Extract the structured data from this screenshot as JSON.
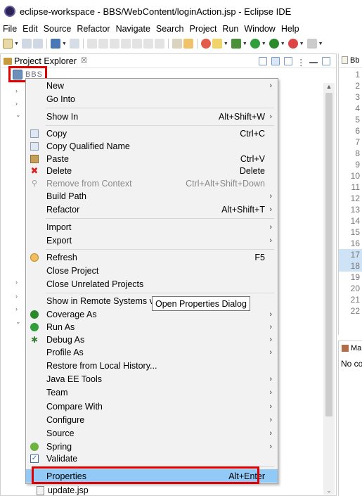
{
  "window": {
    "title": "eclipse-workspace - BBS/WebContent/loginAction.jsp - Eclipse IDE"
  },
  "menubar": [
    "File",
    "Edit",
    "Source",
    "Refactor",
    "Navigate",
    "Search",
    "Project",
    "Run",
    "Window",
    "Help"
  ],
  "explorer": {
    "title": "Project Explorer",
    "close": "☒",
    "project_name": "BBS",
    "bottom_file": "update.jsp"
  },
  "editor": {
    "tab_label": "Bb",
    "line_numbers": [
      "1",
      "2",
      "3",
      "4",
      "5",
      "6",
      "7",
      "8",
      "9",
      "10",
      "11",
      "12",
      "13",
      "14",
      "15",
      "16",
      "17",
      "18",
      "19",
      "20",
      "21",
      "22"
    ]
  },
  "panel2": {
    "tab_label": "Ma",
    "no_content": "No co"
  },
  "context_menu": {
    "new": "New",
    "go_into": "Go Into",
    "show_in": "Show In",
    "show_in_sc": "Alt+Shift+W",
    "copy": "Copy",
    "copy_sc": "Ctrl+C",
    "copy_qualified": "Copy Qualified Name",
    "paste": "Paste",
    "paste_sc": "Ctrl+V",
    "delete": "Delete",
    "delete_sc": "Delete",
    "remove_ctx": "Remove from Context",
    "remove_ctx_sc": "Ctrl+Alt+Shift+Down",
    "build_path": "Build Path",
    "refactor": "Refactor",
    "refactor_sc": "Alt+Shift+T",
    "import": "Import",
    "export": "Export",
    "refresh": "Refresh",
    "refresh_sc": "F5",
    "close_project": "Close Project",
    "close_unrelated": "Close Unrelated Projects",
    "show_remote": "Show in Remote Systems vi",
    "coverage_as": "Coverage As",
    "run_as": "Run As",
    "debug_as": "Debug As",
    "profile_as": "Profile As",
    "restore_history": "Restore from Local History...",
    "java_ee_tools": "Java EE Tools",
    "team": "Team",
    "compare_with": "Compare With",
    "configure": "Configure",
    "source": "Source",
    "spring": "Spring",
    "validate": "Validate",
    "properties": "Properties",
    "properties_sc": "Alt+Enter",
    "arrow": "›"
  },
  "tooltip": "Open Properties Dialog"
}
